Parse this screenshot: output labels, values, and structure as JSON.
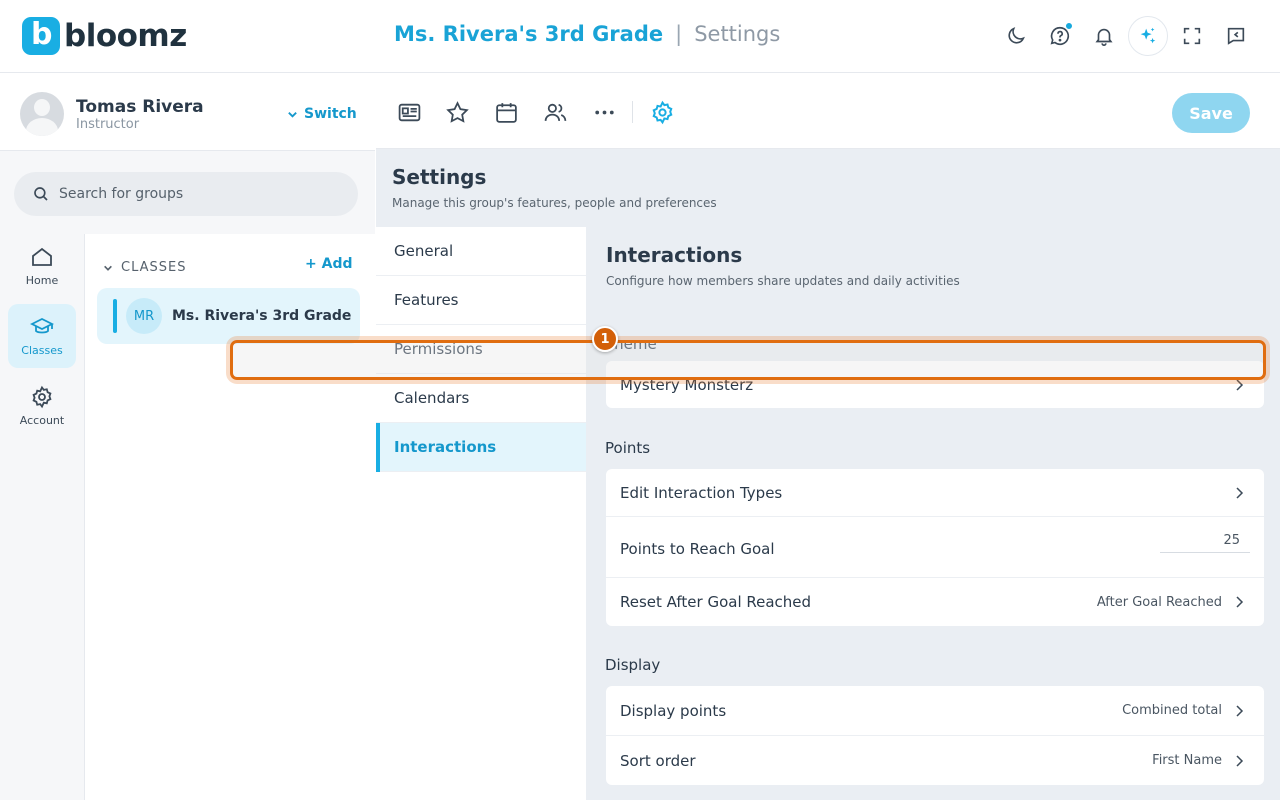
{
  "brand": {
    "name": "bloomz",
    "mark": "b"
  },
  "header": {
    "group_title": "Ms. Rivera's 3rd Grade",
    "separator": "|",
    "page_title": "Settings"
  },
  "user": {
    "name": "Tomas Rivera",
    "role": "Instructor",
    "switch_label": "Switch"
  },
  "search": {
    "placeholder": "Search for groups"
  },
  "rail": [
    {
      "label": "Home"
    },
    {
      "label": "Classes"
    },
    {
      "label": "Account"
    }
  ],
  "classes": {
    "heading": "CLASSES",
    "add_label": "+ Add",
    "items": [
      {
        "initials": "MR",
        "name": "Ms. Rivera's 3rd Grade"
      }
    ]
  },
  "toolbar": {
    "save_label": "Save"
  },
  "settings": {
    "title": "Settings",
    "subtitle": "Manage this group's features, people and preferences",
    "nav": [
      "General",
      "Features",
      "Permissions",
      "Calendars",
      "Interactions"
    ],
    "active_nav": "Interactions"
  },
  "interactions": {
    "title": "Interactions",
    "subtitle": "Configure how members share updates and daily activities",
    "theme_label": "Theme",
    "theme_value": "Mystery Monsterz",
    "points_label": "Points",
    "edit_types": "Edit Interaction Types",
    "points_goal_label": "Points to Reach Goal",
    "points_goal_value": "25",
    "reset_label": "Reset After Goal Reached",
    "reset_value": "After Goal Reached",
    "display_label": "Display",
    "display_points_label": "Display points",
    "display_points_value": "Combined total",
    "sort_label": "Sort order",
    "sort_value": "First Name"
  },
  "annotation": {
    "step": "1"
  },
  "colors": {
    "accent": "#19aee3",
    "highlight": "#e06d10",
    "save_disabled": "#8fd6f0"
  }
}
